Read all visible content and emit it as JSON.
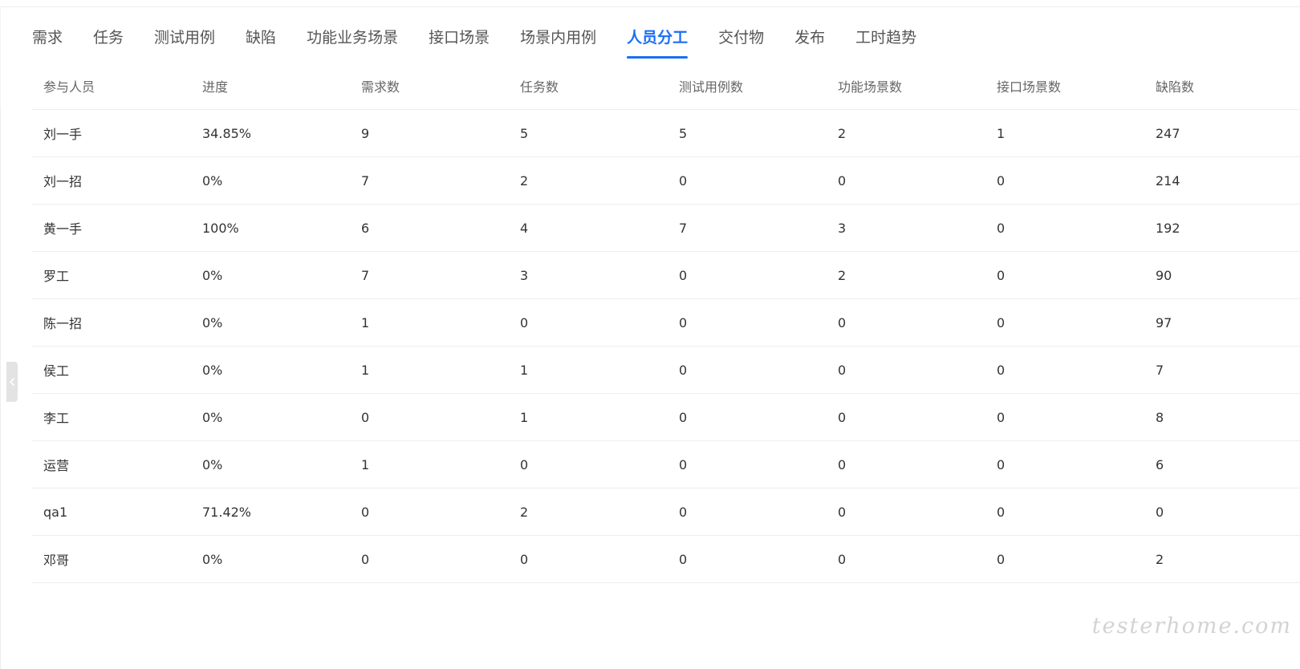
{
  "tabs": [
    {
      "label": "需求",
      "active": false
    },
    {
      "label": "任务",
      "active": false
    },
    {
      "label": "测试用例",
      "active": false
    },
    {
      "label": "缺陷",
      "active": false
    },
    {
      "label": "功能业务场景",
      "active": false
    },
    {
      "label": "接口场景",
      "active": false
    },
    {
      "label": "场景内用例",
      "active": false
    },
    {
      "label": "人员分工",
      "active": true
    },
    {
      "label": "交付物",
      "active": false
    },
    {
      "label": "发布",
      "active": false
    },
    {
      "label": "工时趋势",
      "active": false
    }
  ],
  "table": {
    "headers": [
      "参与人员",
      "进度",
      "需求数",
      "任务数",
      "测试用例数",
      "功能场景数",
      "接口场景数",
      "缺陷数"
    ],
    "rows": [
      [
        "刘一手",
        "34.85%",
        "9",
        "5",
        "5",
        "2",
        "1",
        "247"
      ],
      [
        "刘一招",
        "0%",
        "7",
        "2",
        "0",
        "0",
        "0",
        "214"
      ],
      [
        "黄一手",
        "100%",
        "6",
        "4",
        "7",
        "3",
        "0",
        "192"
      ],
      [
        "罗工",
        "0%",
        "7",
        "3",
        "0",
        "2",
        "0",
        "90"
      ],
      [
        "陈一招",
        "0%",
        "1",
        "0",
        "0",
        "0",
        "0",
        "97"
      ],
      [
        "侯工",
        "0%",
        "1",
        "1",
        "0",
        "0",
        "0",
        "7"
      ],
      [
        "李工",
        "0%",
        "0",
        "1",
        "0",
        "0",
        "0",
        "8"
      ],
      [
        "运营",
        "0%",
        "1",
        "0",
        "0",
        "0",
        "0",
        "6"
      ],
      [
        "qa1",
        "71.42%",
        "0",
        "2",
        "0",
        "0",
        "0",
        "0"
      ],
      [
        "邓哥",
        "0%",
        "0",
        "0",
        "0",
        "0",
        "0",
        "2"
      ]
    ]
  },
  "watermark": "testerhome.com",
  "colors": {
    "accent": "#1a6ff5",
    "text": "#333333",
    "header_text": "#666666",
    "border": "#eeeeee"
  },
  "icons": {
    "collapse_handle": "chevron-left-icon"
  }
}
